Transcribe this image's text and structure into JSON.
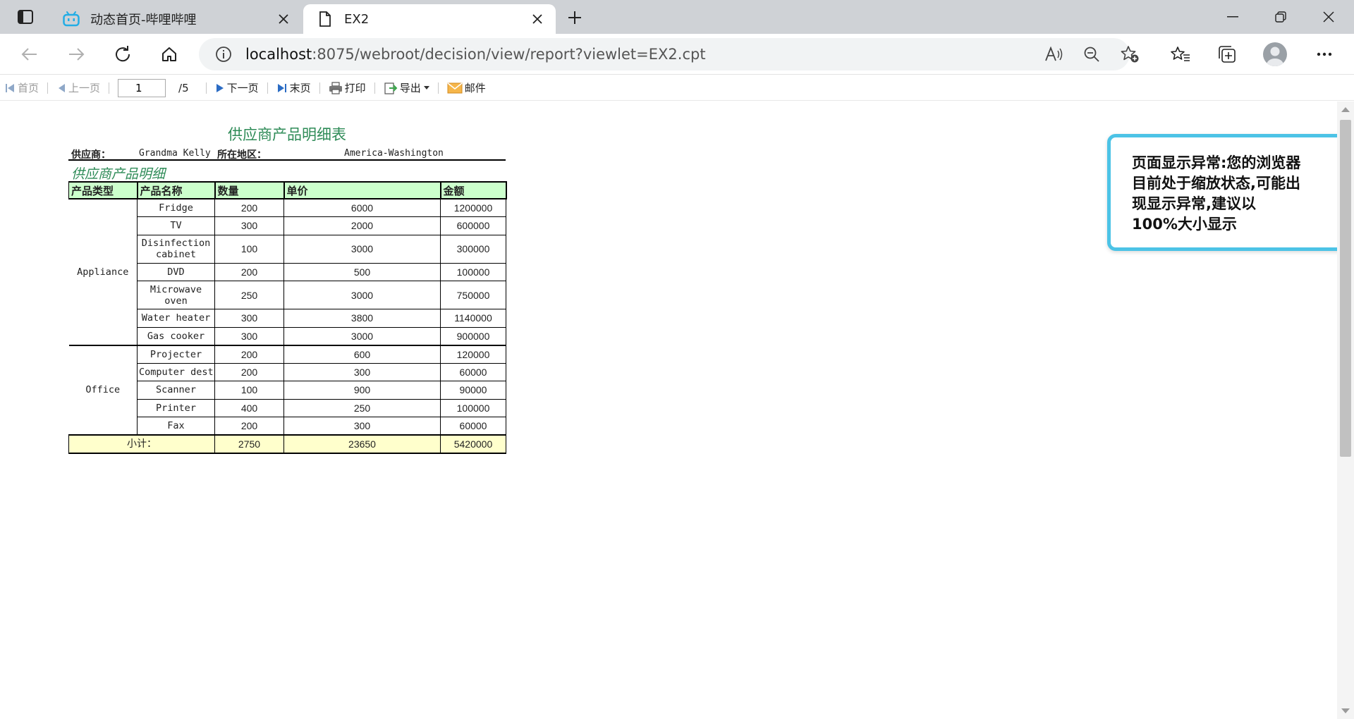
{
  "browser": {
    "tabs": [
      {
        "title": "动态首页-哔哩哔哩",
        "icon": "bilibili-icon",
        "active": false
      },
      {
        "title": "EX2",
        "icon": "page-icon",
        "active": true
      }
    ],
    "url_host": "localhost",
    "url_rest": ":8075/webroot/decision/view/report?viewlet=EX2.cpt"
  },
  "report_toolbar": {
    "first": "首页",
    "prev": "上一页",
    "page_value": "1",
    "page_total": "/5",
    "next": "下一页",
    "last": "末页",
    "print": "打印",
    "export": "导出",
    "mail": "邮件"
  },
  "report": {
    "title": "供应商产品明细表",
    "supplier_label": "供应商：",
    "supplier_value": "Grandma Kelly",
    "region_label": "所在地区：",
    "region_value": "America-Washington",
    "section_title": "供应商产品明细",
    "columns": [
      "产品类型",
      "产品名称",
      "数量",
      "单价",
      "金额"
    ],
    "groups": [
      {
        "category": "Appliance",
        "rows": [
          {
            "name": "Fridge",
            "qty": "200",
            "price": "6000",
            "amount": "1200000"
          },
          {
            "name": "TV",
            "qty": "300",
            "price": "2000",
            "amount": "600000"
          },
          {
            "name": "Disinfection cabinet",
            "qty": "100",
            "price": "3000",
            "amount": "300000"
          },
          {
            "name": "DVD",
            "qty": "200",
            "price": "500",
            "amount": "100000"
          },
          {
            "name": "Microwave oven",
            "qty": "250",
            "price": "3000",
            "amount": "750000"
          },
          {
            "name": "Water heater",
            "qty": "300",
            "price": "3800",
            "amount": "1140000"
          },
          {
            "name": "Gas cooker",
            "qty": "300",
            "price": "3000",
            "amount": "900000"
          }
        ]
      },
      {
        "category": "Office",
        "rows": [
          {
            "name": "Projecter",
            "qty": "200",
            "price": "600",
            "amount": "120000"
          },
          {
            "name": "Computer dest",
            "qty": "200",
            "price": "300",
            "amount": "60000"
          },
          {
            "name": "Scanner",
            "qty": "100",
            "price": "900",
            "amount": "90000"
          },
          {
            "name": "Printer",
            "qty": "400",
            "price": "250",
            "amount": "100000"
          },
          {
            "name": "Fax",
            "qty": "200",
            "price": "300",
            "amount": "60000"
          }
        ]
      }
    ],
    "subtotal": {
      "label": "小计：",
      "qty": "2750",
      "price": "23650",
      "amount": "5420000"
    }
  },
  "warning": {
    "text": "页面显示异常:您的浏览器目前处于缩放状态,可能出现显示异常,建议以100%大小显示"
  },
  "colors": {
    "accent_green": "#2e8b57",
    "header_bg": "#ccffcc",
    "subtotal_bg": "#ffffcc",
    "popup_border": "#4cc3e6",
    "bilibili": "#23ade5"
  }
}
